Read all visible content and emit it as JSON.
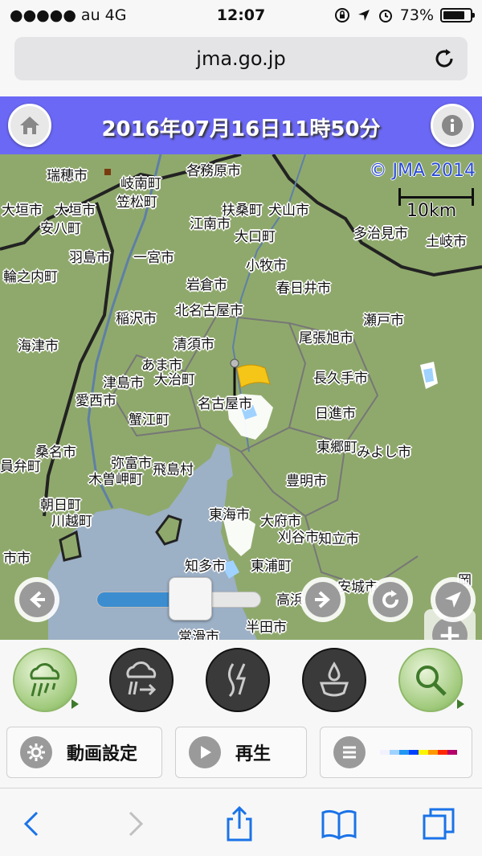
{
  "status_bar": {
    "carrier": "●●●●● au 4G",
    "time": "12:07",
    "battery": "73%"
  },
  "browser": {
    "url": "jma.go.jp"
  },
  "header": {
    "title": "2016年07月16日11時50分"
  },
  "map": {
    "copyright": "© JMA 2014",
    "scale_label": "10km",
    "place_labels": [
      {
        "text": "瑞穂市"
      },
      {
        "text": "岐南町"
      },
      {
        "text": "各務原市"
      },
      {
        "text": "大垣市"
      },
      {
        "text": "大垣市"
      },
      {
        "text": "笠松町"
      },
      {
        "text": "扶桑町"
      },
      {
        "text": "犬山市"
      },
      {
        "text": "安八町"
      },
      {
        "text": "江南市"
      },
      {
        "text": "大口町"
      },
      {
        "text": "多治見市"
      },
      {
        "text": "土岐市"
      },
      {
        "text": "羽島市"
      },
      {
        "text": "一宮市"
      },
      {
        "text": "輪之内町"
      },
      {
        "text": "小牧市"
      },
      {
        "text": "岩倉市"
      },
      {
        "text": "春日井市"
      },
      {
        "text": "稲沢市"
      },
      {
        "text": "北名古屋市"
      },
      {
        "text": "瀬戸市"
      },
      {
        "text": "海津市"
      },
      {
        "text": "清須市"
      },
      {
        "text": "尾張旭市"
      },
      {
        "text": "あま市"
      },
      {
        "text": "長久手市"
      },
      {
        "text": "津島市"
      },
      {
        "text": "大治町"
      },
      {
        "text": "愛西市"
      },
      {
        "text": "名古屋市"
      },
      {
        "text": "日進市"
      },
      {
        "text": "蟹江町"
      },
      {
        "text": "東郷町"
      },
      {
        "text": "みよし市"
      },
      {
        "text": "桑名市"
      },
      {
        "text": "弥富市"
      },
      {
        "text": "飛島村"
      },
      {
        "text": "員弁町"
      },
      {
        "text": "木曽岬町"
      },
      {
        "text": "豊明市"
      },
      {
        "text": "朝日町"
      },
      {
        "text": "川越町"
      },
      {
        "text": "東海市"
      },
      {
        "text": "大府市"
      },
      {
        "text": "刈谷市"
      },
      {
        "text": "知立市"
      },
      {
        "text": "市市"
      },
      {
        "text": "知多市"
      },
      {
        "text": "東浦町"
      },
      {
        "text": "高浜"
      },
      {
        "text": "安城市"
      },
      {
        "text": "岡"
      },
      {
        "text": "半田市"
      },
      {
        "text": "常滑市"
      }
    ],
    "playback_position": 0.57
  },
  "modes": [
    {
      "name": "rain",
      "active": true
    },
    {
      "name": "wind-rain",
      "active": false
    },
    {
      "name": "lightning",
      "active": false
    },
    {
      "name": "water-drop",
      "active": false
    },
    {
      "name": "search",
      "active": true
    }
  ],
  "controls": {
    "settings_label": "動画設定",
    "play_label": "再生"
  },
  "legend_colors": [
    "#f2f2ff",
    "#a0d2ff",
    "#2196f3",
    "#0041ff",
    "#faf500",
    "#ff9900",
    "#ff2800",
    "#b40068"
  ]
}
